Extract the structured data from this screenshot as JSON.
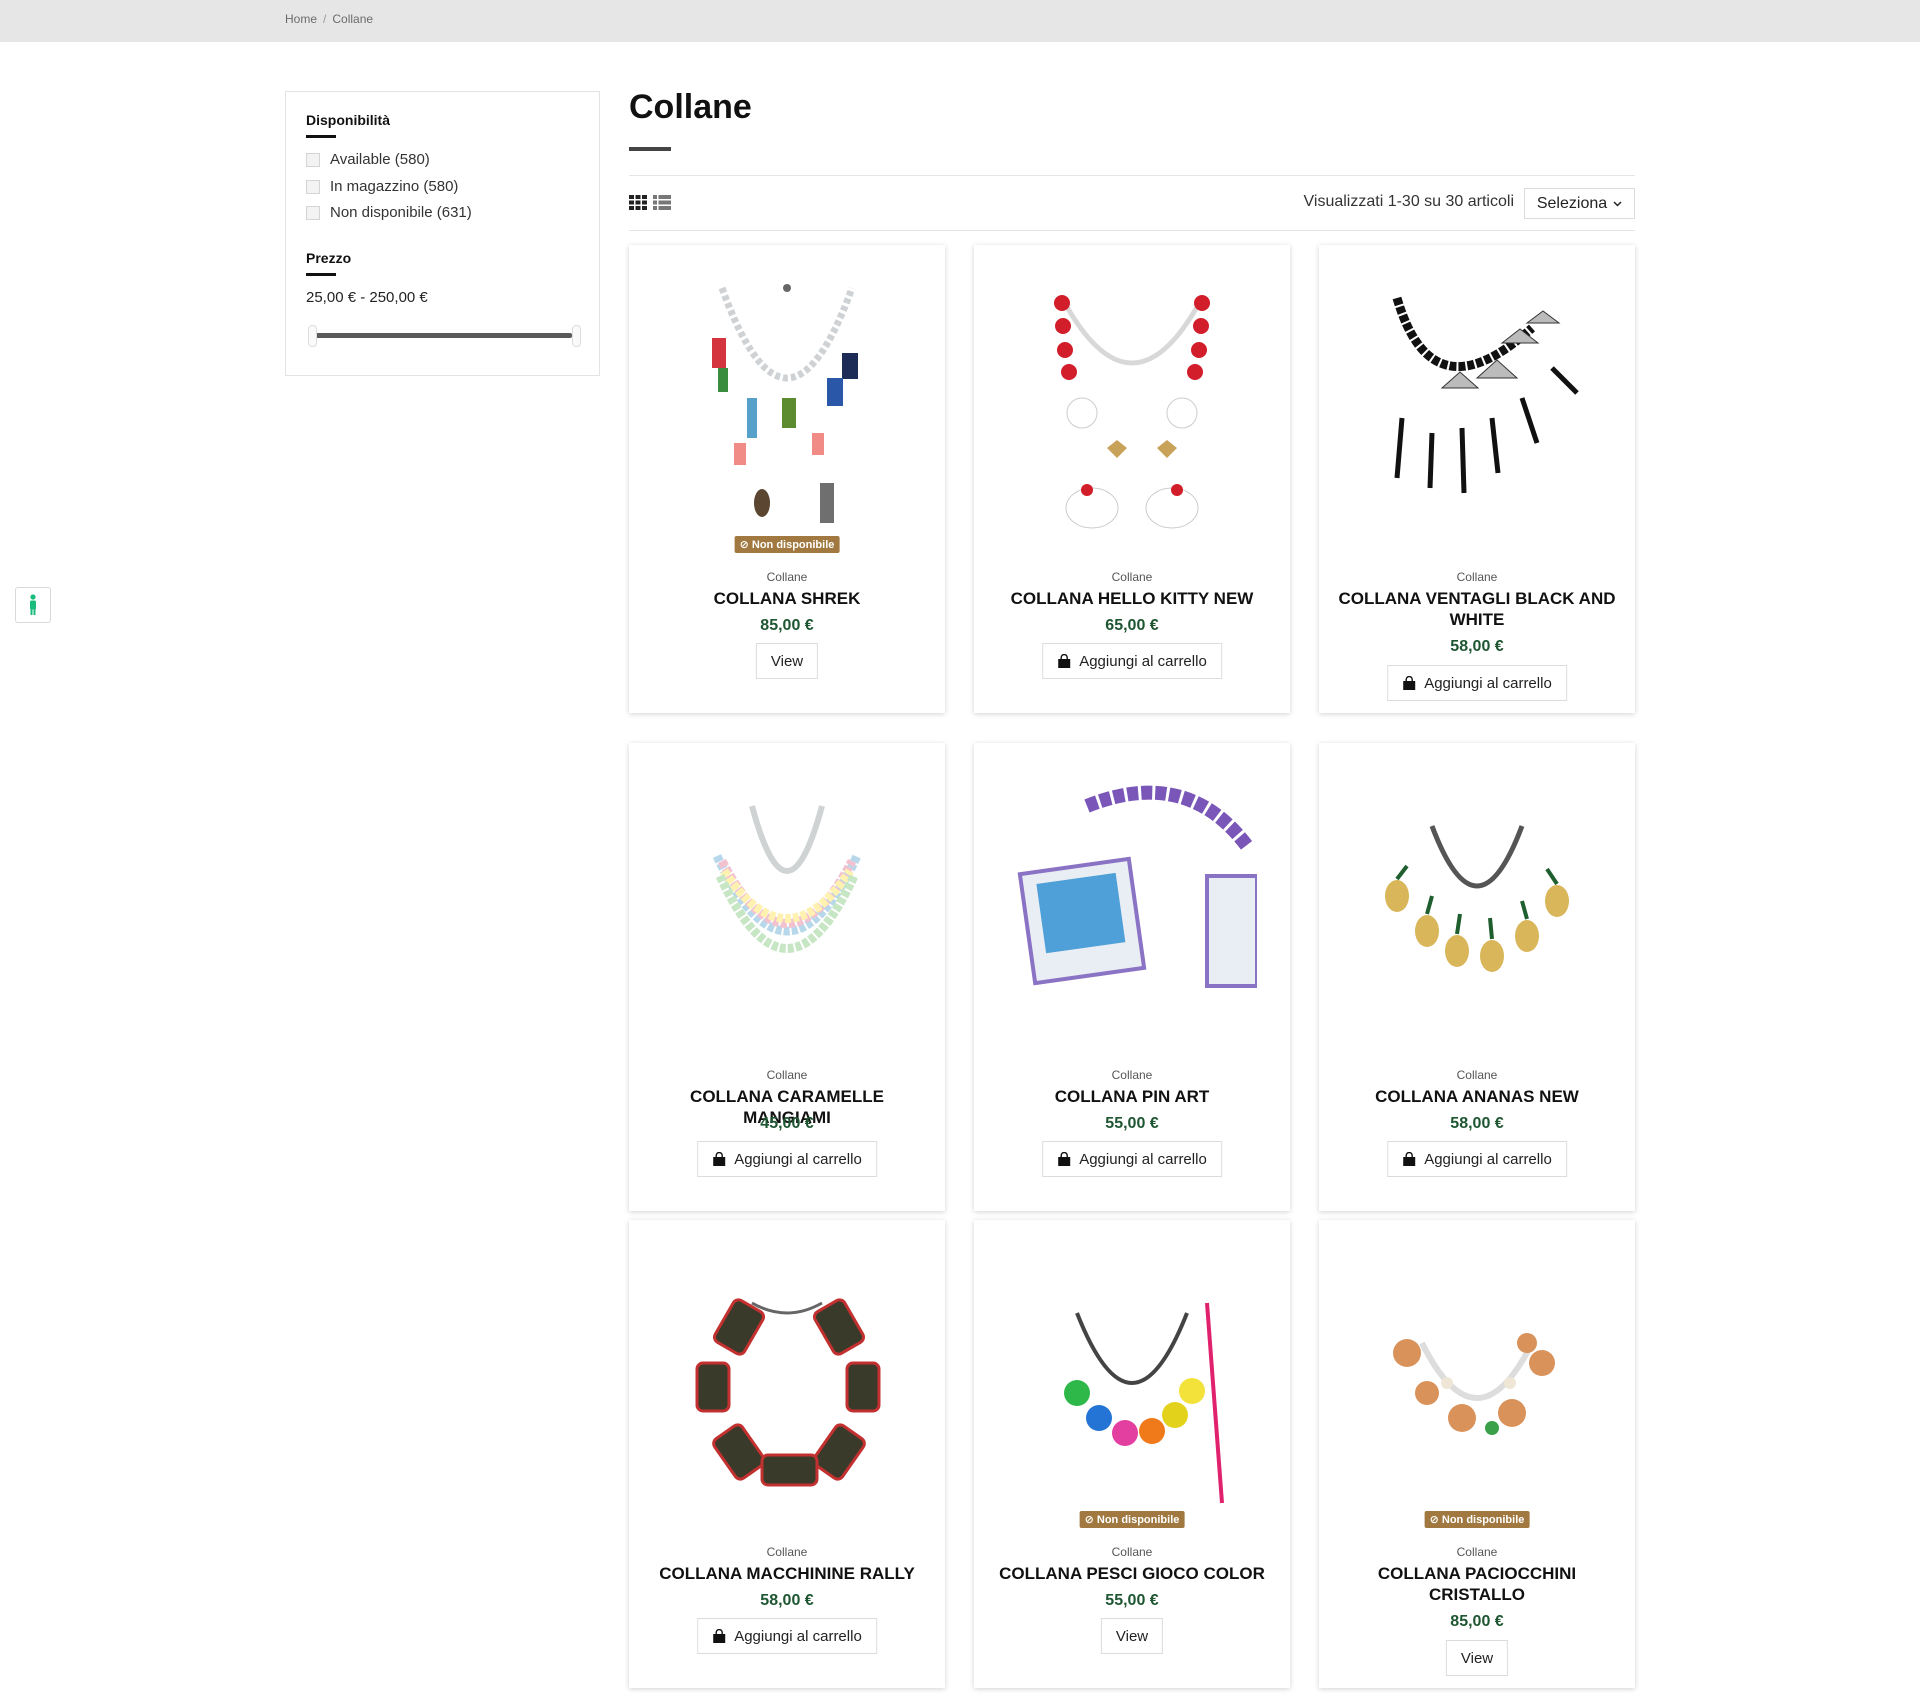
{
  "breadcrumb": {
    "home": "Home",
    "current": "Collane"
  },
  "filters": {
    "availability": {
      "title": "Disponibilità",
      "options": [
        {
          "label": "Available (580)"
        },
        {
          "label": "In magazzino (580)"
        },
        {
          "label": "Non disponibile (631)"
        }
      ]
    },
    "price": {
      "title": "Prezzo",
      "range": "25,00 € - 250,00 €"
    }
  },
  "page": {
    "title": "Collane",
    "count_text": "Visualizzati 1-30 su 30 articoli",
    "sort_label": "Seleziona"
  },
  "products": [
    {
      "category": "Collane",
      "name": "COLLANA SHREK",
      "price": "85,00 €",
      "action": "View",
      "badge": "⊘ Non disponibile"
    },
    {
      "category": "Collane",
      "name": "COLLANA HELLO KITTY NEW",
      "price": "65,00 €",
      "action": "Aggiungi al carrello"
    },
    {
      "category": "Collane",
      "name": "COLLANA VENTAGLI BLACK AND WHITE",
      "price": "58,00 €",
      "action": "Aggiungi al carrello"
    },
    {
      "category": "Collane",
      "name": "COLLANA CARAMELLE MANGIAMI",
      "price": "45,00 €",
      "action": "Aggiungi al carrello"
    },
    {
      "category": "Collane",
      "name": "COLLANA PIN ART",
      "price": "55,00 €",
      "action": "Aggiungi al carrello"
    },
    {
      "category": "Collane",
      "name": "COLLANA ANANAS NEW",
      "price": "58,00 €",
      "action": "Aggiungi al carrello"
    },
    {
      "category": "Collane",
      "name": "COLLANA MACCHININE RALLY",
      "price": "58,00 €",
      "action": "Aggiungi al carrello"
    },
    {
      "category": "Collane",
      "name": "COLLANA PESCI GIOCO COLOR",
      "price": "55,00 €",
      "action": "View",
      "badge": "⊘ Non disponibile"
    },
    {
      "category": "Collane",
      "name": "COLLANA PACIOCCHINI CRISTALLO",
      "price": "85,00 €",
      "action": "View",
      "badge": "⊘ Non disponibile"
    }
  ],
  "colors": {
    "price": "#1e5632",
    "badge": "#a07840",
    "a11y": "#1abc7b"
  }
}
